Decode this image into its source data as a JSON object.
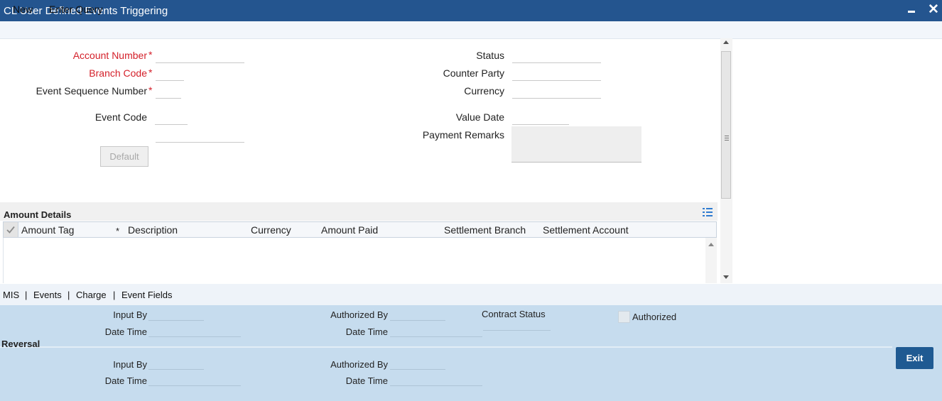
{
  "window": {
    "title": "CL User Defined Events Triggering"
  },
  "menu": {
    "new_label": "New",
    "enter_query_label": "Enter Query"
  },
  "form": {
    "account_number_label": "Account Number",
    "branch_code_label": "Branch Code",
    "event_seq_label": "Event Sequence Number",
    "event_code_label": "Event Code",
    "default_label": "Default",
    "status_label": "Status",
    "counter_party_label": "Counter Party",
    "currency_label": "Currency",
    "value_date_label": "Value Date",
    "payment_remarks_label": "Payment Remarks",
    "required_mark": "*"
  },
  "amount_details": {
    "title": "Amount Details",
    "columns": [
      "Amount Tag",
      "Description",
      "Currency",
      "Amount Paid",
      "Settlement Branch",
      "Settlement Account"
    ],
    "required_mark": "*",
    "rows": []
  },
  "tabs": [
    "MIS",
    "Events",
    "Charge",
    "Event Fields"
  ],
  "tab_separator": "|",
  "audit": {
    "input_by": "Input By",
    "date_time": "Date Time",
    "authorized_by": "Authorized By",
    "contract_status": "Contract Status",
    "authorized": "Authorized",
    "reversal": "Reversal"
  },
  "exit_label": "Exit",
  "colors": {
    "title_bar": "#24558f",
    "required": "#d4202a",
    "audit_bg": "#c6dcee",
    "exit_button": "#1f5a92"
  }
}
